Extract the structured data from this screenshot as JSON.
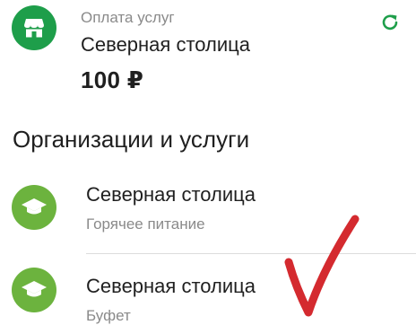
{
  "payment": {
    "caption": "Оплата услуг",
    "name": "Северная столица",
    "amount": "100 ₽",
    "icon": "storefront-icon",
    "refresh_icon": "refresh-icon",
    "accent": "#1e9e4a"
  },
  "section": {
    "title": "Организации и услуги"
  },
  "organizations": [
    {
      "name": "Северная столица",
      "subtitle": "Горячее питание",
      "icon": "graduation-cap-icon",
      "color": "#6cb33e"
    },
    {
      "name": "Северная столица",
      "subtitle": "Буфет",
      "icon": "graduation-cap-icon",
      "color": "#6cb33e"
    }
  ],
  "annotation": {
    "icon": "red-checkmark-icon",
    "color": "#d42a2f"
  }
}
